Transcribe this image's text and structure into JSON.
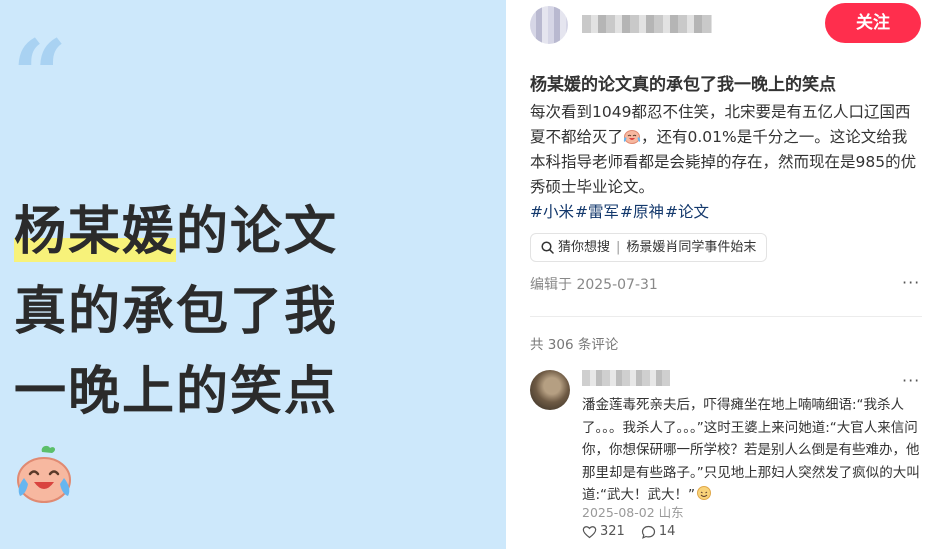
{
  "cover": {
    "quote_mark": "“",
    "title_lines": [
      "杨某媛",
      "的论文",
      "真的承包了我",
      "一晚上的笑点"
    ]
  },
  "header": {
    "follow_label": "关注"
  },
  "note": {
    "title": "杨某媛的论文真的承包了我一晚上的笑点",
    "body_part1": "每次看到1049都忍不住笑，北宋要是有五亿人口辽国西夏不都给灭了",
    "body_part2": "，还有0.01%是千分之一。这论文给我本科指导老师看都是会毙掉的存在，然而现在是985的优秀硕士毕业论文。",
    "tags": [
      "#小米",
      "#雷军",
      "#原神",
      "#论文"
    ],
    "search_chip_prefix": "猜你想搜",
    "search_chip_query": "杨景媛肖同学事件始末",
    "edit_date": "编辑于 2025-07-31",
    "more": "···"
  },
  "comments": {
    "count_label": "共 306 条评论",
    "items": [
      {
        "text": "潘金莲毒死亲夫后，吓得瘫坐在地上喃喃细语:“我杀人了。。。我杀人了。。。”这时王婆上来问她道:“大官人来信问你，你想保研哪一所学校？若是别人么倒是有些难办，他那里却是有些路子。”只见地上那妇人突然发了疯似的大叫道:“武大！武大！”",
        "date_location": "2025-08-02 山东",
        "likes": "321",
        "replies": "14",
        "more": "···"
      }
    ]
  },
  "colors": {
    "cover_bg": "#cde8fb",
    "highlight": "#f7f27a",
    "follow_button": "#ff2e4d",
    "tag_link": "#13386c"
  }
}
